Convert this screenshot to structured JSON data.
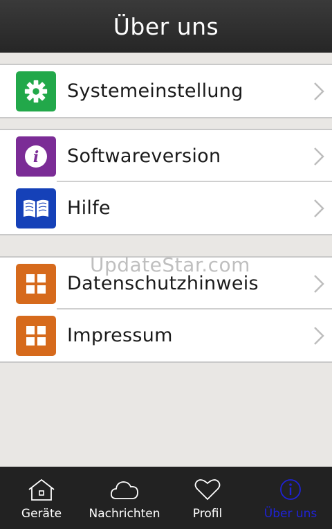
{
  "header": {
    "title": "Über uns"
  },
  "groups": [
    {
      "items": [
        {
          "label": "Systemeinstellung",
          "icon": "gear-icon",
          "color": "#22a84a"
        }
      ]
    },
    {
      "items": [
        {
          "label": "Softwareversion",
          "icon": "info-icon",
          "color": "#7b2c96"
        },
        {
          "label": "Hilfe",
          "icon": "book-icon",
          "color": "#1541b8"
        }
      ]
    },
    {
      "items": [
        {
          "label": "Datenschutzhinweis",
          "icon": "grid-icon",
          "color": "#d66a1c"
        },
        {
          "label": "Impressum",
          "icon": "grid-icon",
          "color": "#d66a1c"
        }
      ]
    }
  ],
  "watermark": "UpdateStar.com",
  "tabs": [
    {
      "label": "Geräte",
      "icon": "house-icon"
    },
    {
      "label": "Nachrichten",
      "icon": "cloud-icon"
    },
    {
      "label": "Profil",
      "icon": "heart-icon"
    },
    {
      "label": "Über uns",
      "icon": "info-circle-icon",
      "active": true
    }
  ],
  "colors": {
    "active_tab": "#1f22d6",
    "header_bg": "#2e2e2e",
    "tabbar_bg": "#222222"
  }
}
